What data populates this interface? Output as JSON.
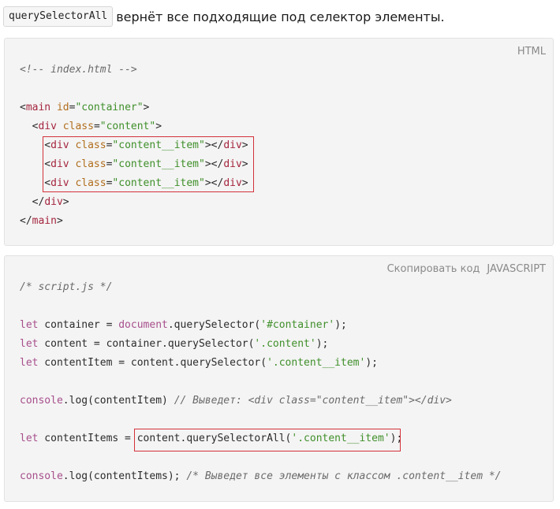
{
  "intro": {
    "code": "querySelectorAll",
    "text": "вернёт все подходящие под селектор элементы."
  },
  "html_block": {
    "language": "HTML",
    "lines": [
      [
        {
          "t": "<!-- index.html -->",
          "c": "comment"
        }
      ],
      [],
      [
        {
          "t": "<",
          "c": "plain"
        },
        {
          "t": "main",
          "c": "tag"
        },
        {
          "t": " ",
          "c": "plain"
        },
        {
          "t": "id",
          "c": "attr"
        },
        {
          "t": "=",
          "c": "plain"
        },
        {
          "t": "\"container\"",
          "c": "str"
        },
        {
          "t": ">",
          "c": "plain"
        }
      ],
      [
        {
          "t": "  <",
          "c": "plain"
        },
        {
          "t": "div",
          "c": "tag"
        },
        {
          "t": " ",
          "c": "plain"
        },
        {
          "t": "class",
          "c": "attr"
        },
        {
          "t": "=",
          "c": "plain"
        },
        {
          "t": "\"content\"",
          "c": "str"
        },
        {
          "t": ">",
          "c": "plain"
        }
      ],
      [
        {
          "t": "    <",
          "c": "plain"
        },
        {
          "t": "div",
          "c": "tag"
        },
        {
          "t": " ",
          "c": "plain"
        },
        {
          "t": "class",
          "c": "attr"
        },
        {
          "t": "=",
          "c": "plain"
        },
        {
          "t": "\"content__item\"",
          "c": "str"
        },
        {
          "t": "></",
          "c": "plain"
        },
        {
          "t": "div",
          "c": "tag"
        },
        {
          "t": ">",
          "c": "plain"
        }
      ],
      [
        {
          "t": "    <",
          "c": "plain"
        },
        {
          "t": "div",
          "c": "tag"
        },
        {
          "t": " ",
          "c": "plain"
        },
        {
          "t": "class",
          "c": "attr"
        },
        {
          "t": "=",
          "c": "plain"
        },
        {
          "t": "\"content__item\"",
          "c": "str"
        },
        {
          "t": "></",
          "c": "plain"
        },
        {
          "t": "div",
          "c": "tag"
        },
        {
          "t": ">",
          "c": "plain"
        }
      ],
      [
        {
          "t": "    <",
          "c": "plain"
        },
        {
          "t": "div",
          "c": "tag"
        },
        {
          "t": " ",
          "c": "plain"
        },
        {
          "t": "class",
          "c": "attr"
        },
        {
          "t": "=",
          "c": "plain"
        },
        {
          "t": "\"content__item\"",
          "c": "str"
        },
        {
          "t": "></",
          "c": "plain"
        },
        {
          "t": "div",
          "c": "tag"
        },
        {
          "t": ">",
          "c": "plain"
        }
      ],
      [
        {
          "t": "  </",
          "c": "plain"
        },
        {
          "t": "div",
          "c": "tag"
        },
        {
          "t": ">",
          "c": "plain"
        }
      ],
      [
        {
          "t": "</",
          "c": "plain"
        },
        {
          "t": "main",
          "c": "tag"
        },
        {
          "t": ">",
          "c": "plain"
        }
      ]
    ]
  },
  "js_block": {
    "copy_label": "Скопировать код",
    "language": "JAVASCRIPT",
    "lines": [
      [
        {
          "t": "/* script.js */",
          "c": "comment"
        }
      ],
      [],
      [
        {
          "t": "let",
          "c": "kw"
        },
        {
          "t": " container = ",
          "c": "plain"
        },
        {
          "t": "document",
          "c": "kw"
        },
        {
          "t": ".querySelector(",
          "c": "plain"
        },
        {
          "t": "'#container'",
          "c": "str"
        },
        {
          "t": ");",
          "c": "plain"
        }
      ],
      [
        {
          "t": "let",
          "c": "kw"
        },
        {
          "t": " content = container.querySelector(",
          "c": "plain"
        },
        {
          "t": "'.content'",
          "c": "str"
        },
        {
          "t": ");",
          "c": "plain"
        }
      ],
      [
        {
          "t": "let",
          "c": "kw"
        },
        {
          "t": " contentItem = content.querySelector(",
          "c": "plain"
        },
        {
          "t": "'.content__item'",
          "c": "str"
        },
        {
          "t": ");",
          "c": "plain"
        }
      ],
      [],
      [
        {
          "t": "console",
          "c": "kw"
        },
        {
          "t": ".log(contentItem) ",
          "c": "plain"
        },
        {
          "t": "// Выведет: <div class=\"content__item\"></div>",
          "c": "comment"
        }
      ],
      [],
      [
        {
          "t": "let",
          "c": "kw"
        },
        {
          "t": " contentItems = content.querySelectorAll(",
          "c": "plain"
        },
        {
          "t": "'.content__item'",
          "c": "str"
        },
        {
          "t": ");",
          "c": "plain"
        }
      ],
      [],
      [
        {
          "t": "console",
          "c": "kw"
        },
        {
          "t": ".log(contentItems); ",
          "c": "plain"
        },
        {
          "t": "/* Выведет все элементы с классом .content__item */",
          "c": "comment"
        }
      ]
    ]
  },
  "colors": {
    "highlight_border": "#d3323a",
    "block_background": "#f4f4f4"
  }
}
